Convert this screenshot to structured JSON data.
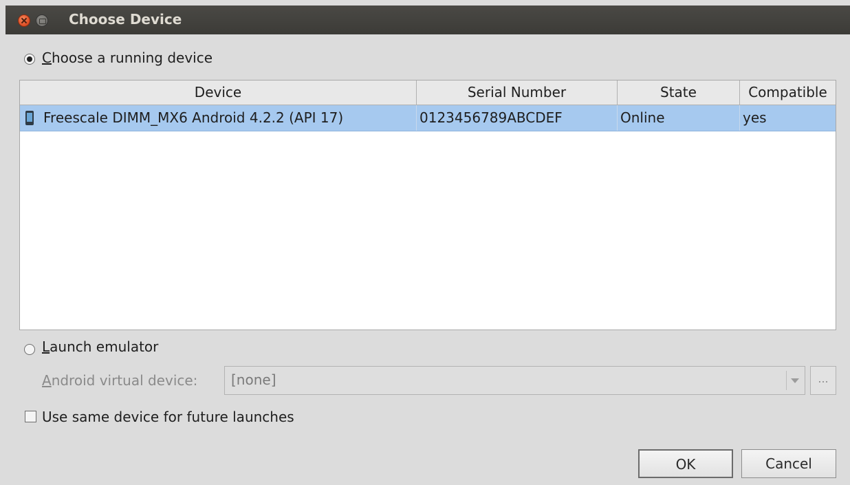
{
  "window": {
    "title": "Choose Device"
  },
  "running": {
    "label": "Choose a running device",
    "selected": true
  },
  "table": {
    "columns": [
      "Device",
      "Serial Number",
      "State",
      "Compatible"
    ],
    "rows": [
      {
        "device": "Freescale DIMM_MX6 Android 4.2.2 (API 17)",
        "serial": "0123456789ABCDEF",
        "state": "Online",
        "compatible": "yes",
        "icon": "phone-icon",
        "selected": true
      }
    ]
  },
  "emulator": {
    "label": "Launch emulator",
    "selected": false,
    "avd_label": "Android virtual device:",
    "avd_value": "[none]",
    "browse_label": "..."
  },
  "future": {
    "label": "Use same device for future launches",
    "checked": false
  },
  "buttons": {
    "ok": "OK",
    "cancel": "Cancel"
  },
  "colors": {
    "titlebar": "#3c3b37",
    "selection": "#a6c9ef",
    "background": "#dcdcdc",
    "close": "#e0532a"
  }
}
